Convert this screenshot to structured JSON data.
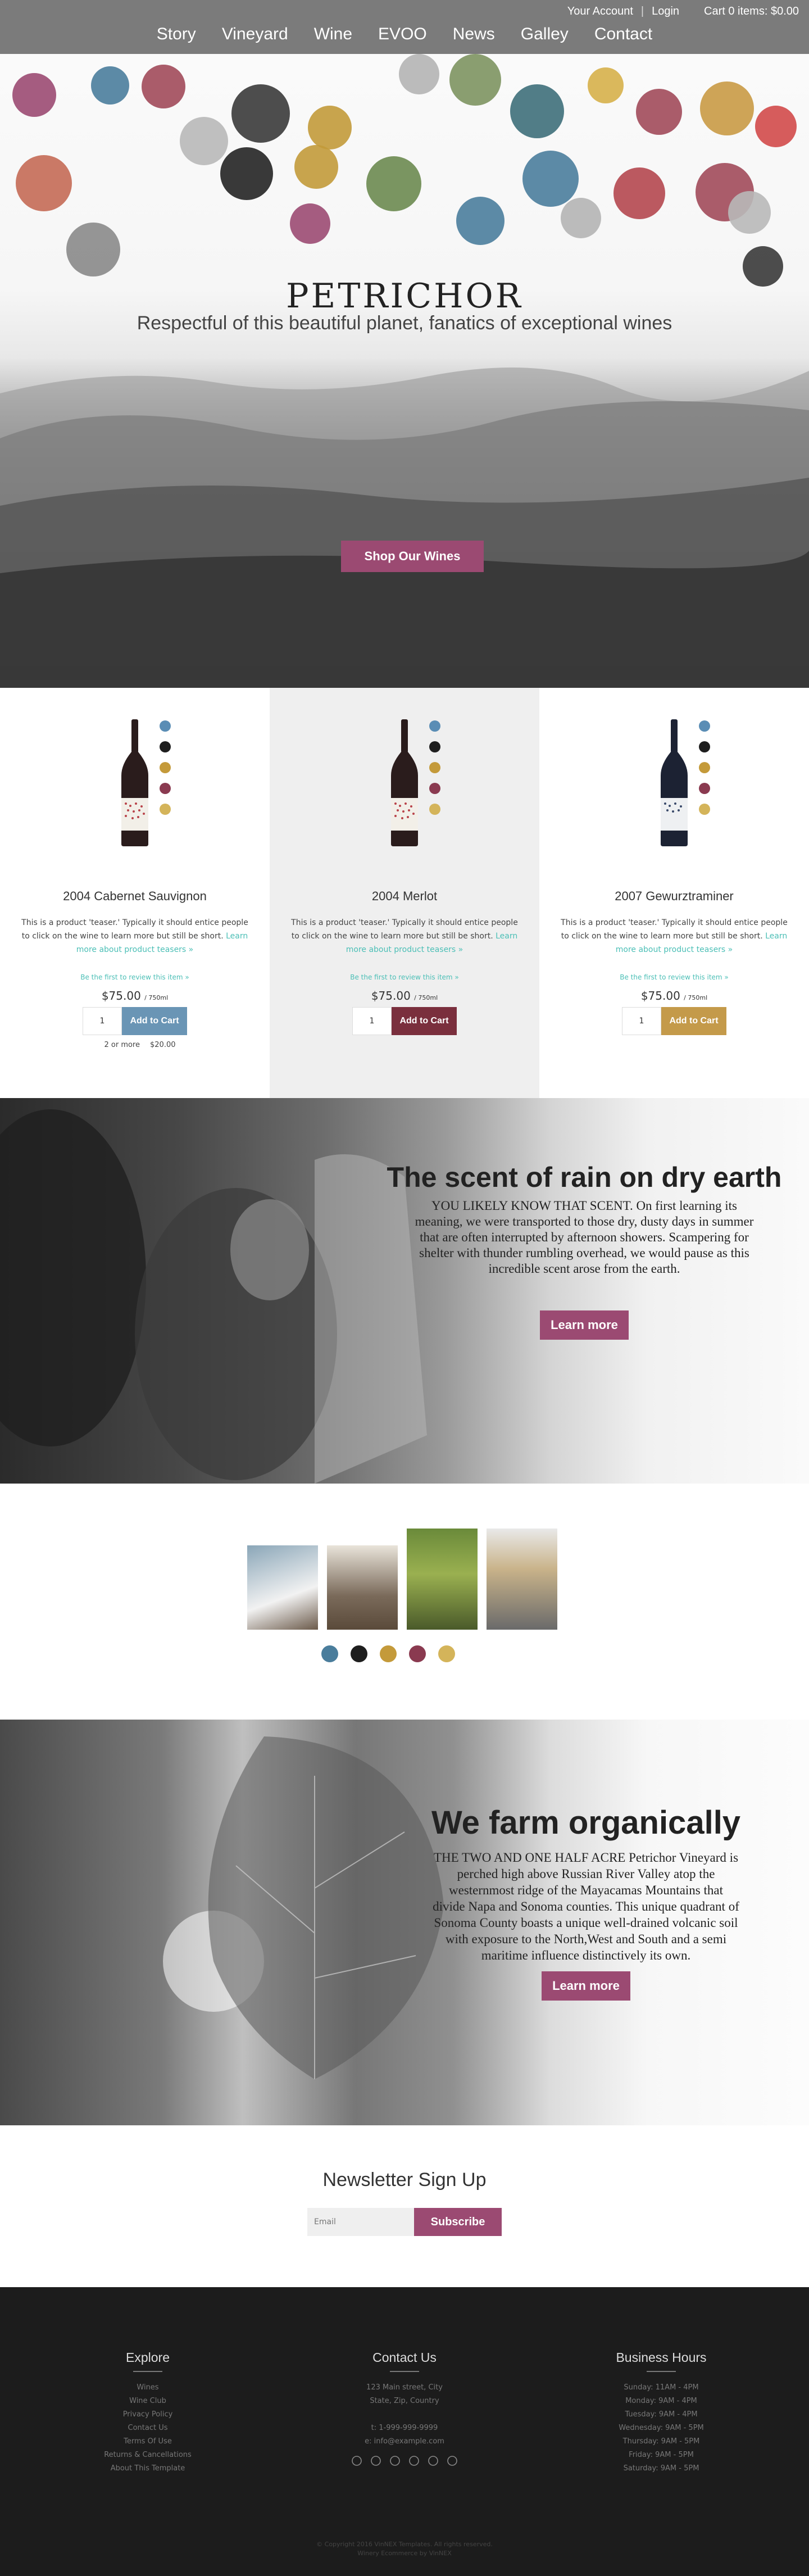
{
  "header": {
    "account": "Your Account",
    "separator": "|",
    "login": "Login",
    "cart": "Cart 0 items: $0.00",
    "nav": [
      "Story",
      "Vineyard",
      "Wine",
      "EVOO",
      "News",
      "Galley",
      "Contact"
    ]
  },
  "hero": {
    "logo": "PETRICHOR",
    "tagline": "Respectful of this beautiful planet, fanatics of exceptional wines",
    "cta": "Shop Our Wines",
    "dot_colors": [
      "#9b4a72",
      "#4a7d9c",
      "#a14a5a",
      "#b8b8b8",
      "#3a3a3a",
      "#c29a3a",
      "#b4b4b4",
      "#7d9460",
      "#3e6f7a",
      "#d6b04a",
      "#a14a5a",
      "#c99a45",
      "#d24a4a",
      "#c46a55",
      "#242424",
      "#6b8a50",
      "#4a7d9c",
      "#b4474f",
      "#8a8a8a"
    ]
  },
  "products": [
    {
      "name": "2004 Cabernet Sauvignon",
      "desc": "This is a product 'teaser.' Typically it should entice people to click on the wine to learn more but still be short.",
      "link": "Learn more about product teasers »",
      "review": "Be the first to review this item »",
      "price": "$75.00",
      "unit": "/ 750ml",
      "qty": "1",
      "add": "Add to Cart",
      "btn_color": "#6a95b5",
      "bulk_label": "2 or more",
      "bulk_price": "$20.00",
      "bottle_color": "#2a1c1c"
    },
    {
      "name": "2004 Merlot",
      "desc": "This is a product 'teaser.' Typically it should entice people to click on the wine to learn more but still be short.",
      "link": "Learn more about product teasers »",
      "review": "Be the first to review this item »",
      "price": "$75.00",
      "unit": "/ 750ml",
      "qty": "1",
      "add": "Add to Cart",
      "btn_color": "#7a2f3d",
      "bulk_label": "",
      "bulk_price": "",
      "bottle_color": "#2a1c1c"
    },
    {
      "name": "2007 Gewurztraminer",
      "desc": "This is a product 'teaser.' Typically it should entice people to click on the wine to learn more but still be short.",
      "link": "Learn more about product teasers »",
      "review": "Be the first to review this item »",
      "price": "$75.00",
      "unit": "/ 750ml",
      "qty": "1",
      "add": "Add to Cart",
      "btn_color": "#c49a4a",
      "bulk_label": "",
      "bulk_price": "",
      "bottle_color": "#1c2233"
    }
  ],
  "mini_dots": [
    "#5a8db5",
    "#1e1e1e",
    "#c49a3a",
    "#8a3a50",
    "#d4b45a"
  ],
  "story": {
    "title": "The scent of rain on dry earth",
    "body": "YOU LIKELY KNOW THAT SCENT. On first learning its meaning, we were transported to those dry, dusty days in summer that are often interrupted by afternoon showers. Scampering for shelter with thunder rumbling overhead, we would pause as this incredible scent arose from the earth.",
    "cta": "Learn more"
  },
  "team": {
    "dots": [
      "#4a7d9c",
      "#1e1e1e",
      "#c49a3a",
      "#8a3a50",
      "#d4b45a"
    ]
  },
  "organic": {
    "title": "We farm organically",
    "body": "THE TWO AND ONE HALF ACRE Petrichor Vineyard is perched high above Russian River Valley atop the westernmost ridge of the Mayacamas Mountains that divide Napa and Sonoma counties. This unique quadrant of Sonoma County boasts a unique well-drained volcanic soil with exposure to the North,West and South and a semi maritime influence distinctively its own.",
    "cta": "Learn more"
  },
  "newsletter": {
    "title": "Newsletter Sign Up",
    "placeholder": "Email",
    "cta": "Subscribe"
  },
  "footer": {
    "explore": {
      "title": "Explore",
      "items": [
        "Wines",
        "Wine Club",
        "Privacy Policy",
        "Contact Us",
        "Terms Of Use",
        "Returns & Cancellations",
        "About This Template"
      ]
    },
    "contact": {
      "title": "Contact Us",
      "items": [
        "123 Main street, City",
        "State, Zip, Country",
        "",
        "t: 1-999-999-9999",
        "e: info@example.com"
      ]
    },
    "hours": {
      "title": "Business Hours",
      "items": [
        "Sunday: 11AM - 4PM",
        "Monday: 9AM - 4PM",
        "Tuesday: 9AM - 4PM",
        "Wednesday: 9AM - 5PM",
        "Thursday: 9AM - 5PM",
        "Friday: 9AM - 5PM",
        "Saturday: 9AM - 5PM"
      ]
    },
    "social": [
      "facebook-icon",
      "twitter-icon",
      "instagram-icon",
      "yelp-icon",
      "tripadvisor-icon",
      "pinterest-icon"
    ],
    "copyright": "© Copyright 2016 VinNEX Templates. All rights reserved.",
    "credit": "Winery Ecommerce by VinNEX"
  }
}
